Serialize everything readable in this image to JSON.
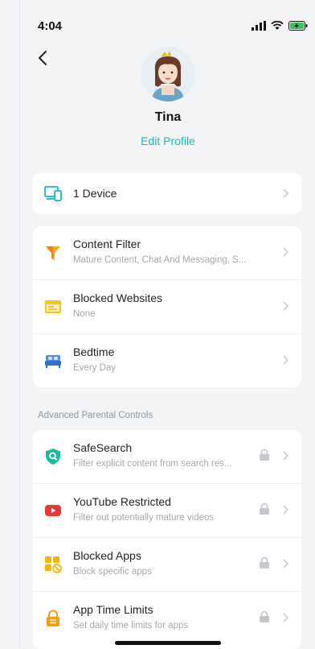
{
  "status": {
    "time": "4:04"
  },
  "profile": {
    "name": "Tina",
    "edit_label": "Edit Profile"
  },
  "devices": {
    "label": "1 Device"
  },
  "main_items": [
    {
      "title": "Content Filter",
      "subtitle": "Mature Content, Chat And Messaging, S...",
      "icon": "funnel-icon",
      "color": "#f5a623"
    },
    {
      "title": "Blocked Websites",
      "subtitle": "None",
      "icon": "browser-window-icon",
      "color": "#f5c518"
    },
    {
      "title": "Bedtime",
      "subtitle": "Every Day",
      "icon": "bed-icon",
      "color": "#4b8de8"
    }
  ],
  "advanced": {
    "section_label": "Advanced Parental Controls",
    "items": [
      {
        "title": "SafeSearch",
        "subtitle": "Filter explicit content from search res...",
        "icon": "shield-search-icon",
        "color": "#1fb89a",
        "locked": true
      },
      {
        "title": "YouTube Restricted",
        "subtitle": "Filter out potentially mature videos",
        "icon": "youtube-icon",
        "color": "#e53935",
        "locked": true
      },
      {
        "title": "Blocked Apps",
        "subtitle": "Block specific apps",
        "icon": "blocked-apps-icon",
        "color": "#f5b400",
        "locked": true
      },
      {
        "title": "App Time Limits",
        "subtitle": "Set daily time limits for apps",
        "icon": "lock-timer-icon",
        "color": "#f39c12",
        "locked": true
      }
    ]
  },
  "colors": {
    "accent": "#19b8b0",
    "background": "#f3f4f6"
  }
}
